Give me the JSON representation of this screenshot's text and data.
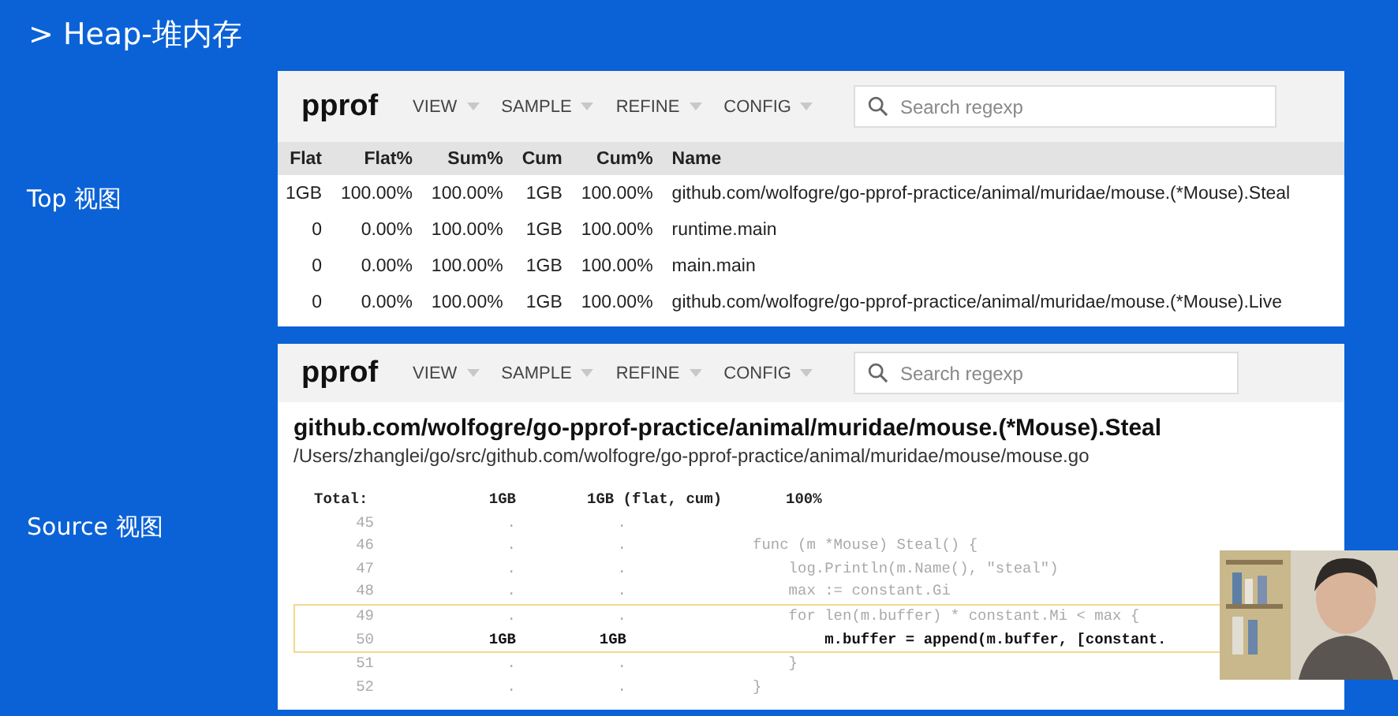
{
  "slide_title": "> Heap-堆内存",
  "top_view": {
    "label": "Top 视图",
    "toolbar": {
      "logo": "pprof",
      "menus": [
        "VIEW",
        "SAMPLE",
        "REFINE",
        "CONFIG"
      ],
      "search": {
        "placeholder": "Search regexp"
      }
    },
    "table": {
      "columns": [
        "Flat",
        "Flat%",
        "Sum%",
        "Cum",
        "Cum%",
        "Name"
      ],
      "rows": [
        [
          "1GB",
          "100.00%",
          "100.00%",
          "1GB",
          "100.00%",
          "github.com/wolfogre/go-pprof-practice/animal/muridae/mouse.(*Mouse).Steal"
        ],
        [
          "0",
          "0.00%",
          "100.00%",
          "1GB",
          "100.00%",
          "runtime.main"
        ],
        [
          "0",
          "0.00%",
          "100.00%",
          "1GB",
          "100.00%",
          "main.main"
        ],
        [
          "0",
          "0.00%",
          "100.00%",
          "1GB",
          "100.00%",
          "github.com/wolfogre/go-pprof-practice/animal/muridae/mouse.(*Mouse).Live"
        ]
      ]
    }
  },
  "source_view": {
    "label": "Source 视图",
    "toolbar": {
      "logo": "pprof",
      "menus": [
        "VIEW",
        "SAMPLE",
        "REFINE",
        "CONFIG"
      ],
      "search": {
        "placeholder": "Search regexp"
      }
    },
    "function_name": "github.com/wolfogre/go-pprof-practice/animal/muridae/mouse.(*Mouse).Steal",
    "file_path": "/Users/zhanglei/go/src/github.com/wolfogre/go-pprof-practice/animal/muridae/mouse/mouse.go",
    "total": {
      "label": "Total:",
      "flat": "1GB",
      "cum": "1GB (flat, cum)",
      "percent": "100%"
    },
    "lines": [
      {
        "number": "45",
        "flat": ".",
        "cum": ".",
        "highlighted": false,
        "hot": false
      },
      {
        "number": "46",
        "flat": ".",
        "cum": ".",
        "code": "func (m *Mouse) Steal() {",
        "highlighted": false,
        "hot": false
      },
      {
        "number": "47",
        "flat": ".",
        "cum": ".",
        "code": "    log.Println(m.Name(), \"steal\")",
        "highlighted": false,
        "hot": false
      },
      {
        "number": "48",
        "flat": ".",
        "cum": ".",
        "code": "    max := constant.Gi",
        "highlighted": false,
        "hot": false
      },
      {
        "number": "49",
        "flat": ".",
        "cum": ".",
        "code": "    for len(m.buffer) * constant.Mi < max {",
        "highlighted": true,
        "hot": false
      },
      {
        "number": "50",
        "flat": "1GB",
        "cum": "1GB",
        "code": "        m.buffer = append(m.buffer, [constant.",
        "highlighted": true,
        "hot": true
      },
      {
        "number": "51",
        "flat": ".",
        "cum": ".",
        "code": "    }",
        "highlighted": false,
        "hot": false
      },
      {
        "number": "52",
        "flat": ".",
        "cum": ".",
        "code": "}",
        "highlighted": false,
        "hot": false
      }
    ]
  }
}
